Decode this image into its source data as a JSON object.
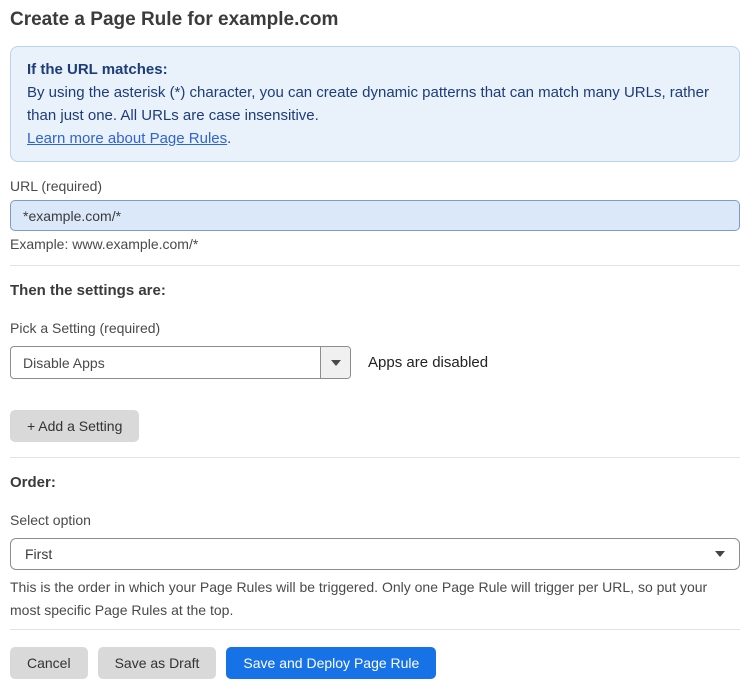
{
  "page": {
    "title": "Create a Page Rule for example.com"
  },
  "info_box": {
    "heading": "If the URL matches:",
    "body": "By using the asterisk (*) character, you can create dynamic patterns that can match many URLs, rather than just one. All URLs are case insensitive.",
    "link_label": "Learn more about Page Rules",
    "link_suffix": "."
  },
  "url_field": {
    "label": "URL (required)",
    "value": "*example.com/*",
    "example": "Example: www.example.com/*"
  },
  "settings_section": {
    "heading": "Then the settings are:",
    "picker_label": "Pick a Setting (required)",
    "selected_setting": "Disable Apps",
    "setting_status": "Apps are disabled",
    "add_setting_label": "+ Add a Setting"
  },
  "order_section": {
    "heading": "Order:",
    "select_label": "Select option",
    "selected_option": "First",
    "description": "This is the order in which your Page Rules will be triggered. Only one Page Rule will trigger per URL, so put your most specific Page Rules at the top."
  },
  "footer": {
    "cancel_label": "Cancel",
    "save_draft_label": "Save as Draft",
    "save_deploy_label": "Save and Deploy Page Rule"
  },
  "colors": {
    "accent_blue": "#1672e6",
    "info_box_bg": "#e9f1fb",
    "info_box_border": "#b8d4f1",
    "info_box_text": "#1d3d7a",
    "link_blue": "#3063d4",
    "url_input_bg": "#dbe8f9",
    "url_input_border": "#7c9cc9",
    "gray_button_bg": "#d9d9d9"
  }
}
